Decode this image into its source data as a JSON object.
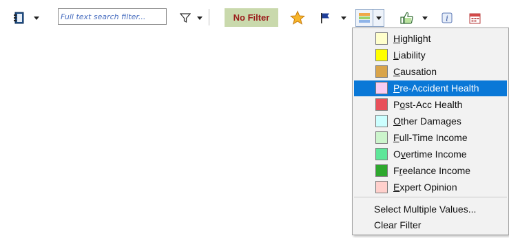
{
  "toolbar": {
    "search": {
      "placeholder": "Full text search filter...",
      "value": ""
    },
    "no_filter_label": "No Filter"
  },
  "icons": {
    "notebook": "notebook-icon",
    "filter": "funnel-icon",
    "star": "star-icon",
    "flag": "flag-icon",
    "colors": "color-stripes-icon",
    "thumbs": "thumbs-up-icon",
    "info": "info-icon",
    "calendar": "calendar-icon"
  },
  "menu": {
    "items": [
      {
        "label": "Highlight",
        "ul": "H",
        "rest": "ighlight",
        "color": "#ffffcc"
      },
      {
        "label": "Liability",
        "ul": "L",
        "rest": "iability",
        "color": "#ffff00"
      },
      {
        "label": "Causation",
        "ul": "C",
        "rest": "ausation",
        "color": "#d9a44a"
      },
      {
        "label": "Pre-Accident Health",
        "ul": "P",
        "rest": "re-Accident Health",
        "color": "#f9ccf2"
      },
      {
        "label": "Post-Acc Health",
        "pre": "P",
        "ul": "o",
        "rest": "st-Acc Health",
        "color": "#e8505a"
      },
      {
        "label": "Other Damages",
        "ul": "O",
        "rest": "ther Damages",
        "color": "#ccffff"
      },
      {
        "label": "Full-Time Income",
        "ul": "F",
        "rest": "ull-Time Income",
        "color": "#ccf5cc"
      },
      {
        "label": "Overtime Income",
        "pre": "O",
        "ul": "v",
        "rest": "ertime Income",
        "color": "#5ee699"
      },
      {
        "label": "Freelance Income",
        "pre": "F",
        "ul": "r",
        "rest": "eelance Income",
        "color": "#2ea82e"
      },
      {
        "label": "Expert Opinion",
        "ul": "E",
        "rest": "xpert Opinion",
        "color": "#ffd0cc"
      }
    ],
    "selected_index": 3,
    "select_multiple": "Select Multiple Values...",
    "clear_filter": "Clear Filter"
  }
}
